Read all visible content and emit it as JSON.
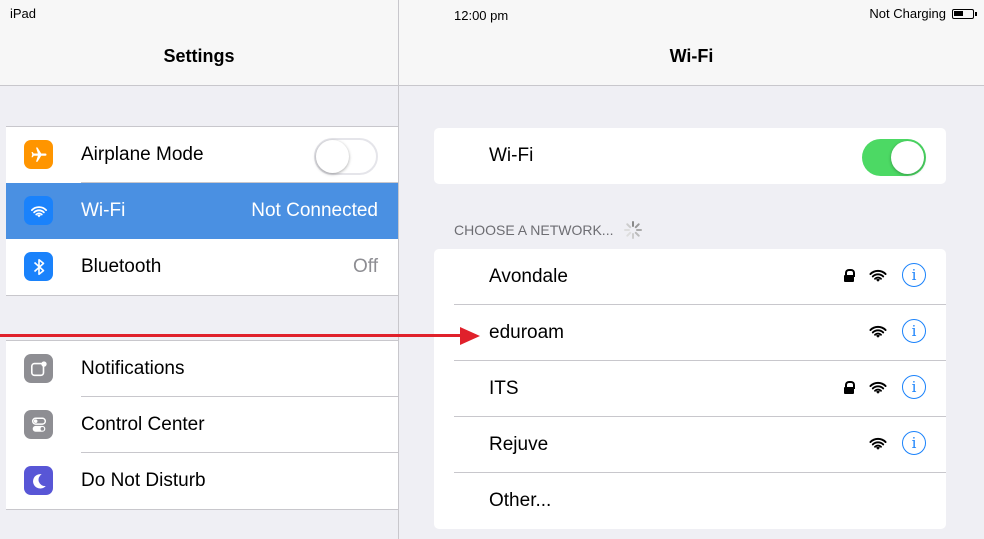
{
  "status_bar": {
    "device": "iPad",
    "time": "12:00 pm",
    "charging": "Not Charging"
  },
  "left_pane": {
    "title": "Settings",
    "group1": [
      {
        "label": "Airplane Mode",
        "icon": "airplane-icon",
        "color": "#ff9500",
        "control": "toggle",
        "toggle_on": false
      },
      {
        "label": "Wi-Fi",
        "value": "Not Connected",
        "icon": "wifi-icon",
        "color": "#007aff",
        "selected": true
      },
      {
        "label": "Bluetooth",
        "value": "Off",
        "icon": "bluetooth-icon",
        "color": "#007aff"
      }
    ],
    "group2": [
      {
        "label": "Notifications",
        "icon": "notifications-icon",
        "color": "#8e8e93"
      },
      {
        "label": "Control Center",
        "icon": "control-center-icon",
        "color": "#8e8e93"
      },
      {
        "label": "Do Not Disturb",
        "icon": "moon-icon",
        "color": "#5856d6"
      }
    ]
  },
  "right_pane": {
    "title": "Wi-Fi",
    "wifi_row": {
      "label": "Wi-Fi",
      "toggle_on": true
    },
    "section_label": "CHOOSE A NETWORK...",
    "networks": [
      {
        "name": "Avondale",
        "secured": true
      },
      {
        "name": "eduroam",
        "secured": false
      },
      {
        "name": "ITS",
        "secured": true
      },
      {
        "name": "Rejuve",
        "secured": false
      }
    ],
    "other_label": "Other..."
  },
  "annotation": {
    "arrow_color": "#e0212b"
  }
}
